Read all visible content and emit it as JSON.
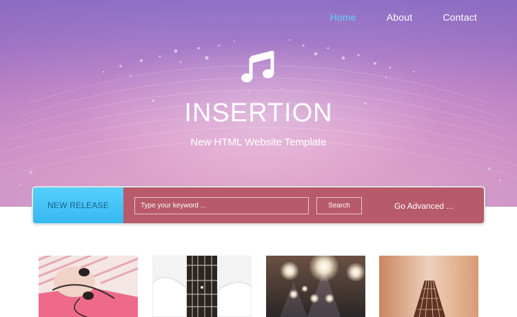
{
  "nav": {
    "items": [
      {
        "label": "Home",
        "active": true
      },
      {
        "label": "About",
        "active": false
      },
      {
        "label": "Contact",
        "active": false
      }
    ],
    "active_color": "#5fd0ff"
  },
  "hero": {
    "icon": "music-note-icon",
    "title": "INSERTION",
    "subtitle": "New HTML Website Template"
  },
  "search_bar": {
    "new_release_label": "NEW RELEASE",
    "keyword_placeholder": "Type your keyword ...",
    "keyword_value": "",
    "search_button_label": "Search",
    "advanced_link_label": "Go Advanced ...",
    "new_release_color": "#45c3f6",
    "panel_color": "#b75a6a"
  },
  "gallery": {
    "thumbnails": [
      {
        "subject": "person-with-headphones"
      },
      {
        "subject": "white-bass-guitar"
      },
      {
        "subject": "stage-lights"
      },
      {
        "subject": "guitar-neck"
      }
    ]
  }
}
